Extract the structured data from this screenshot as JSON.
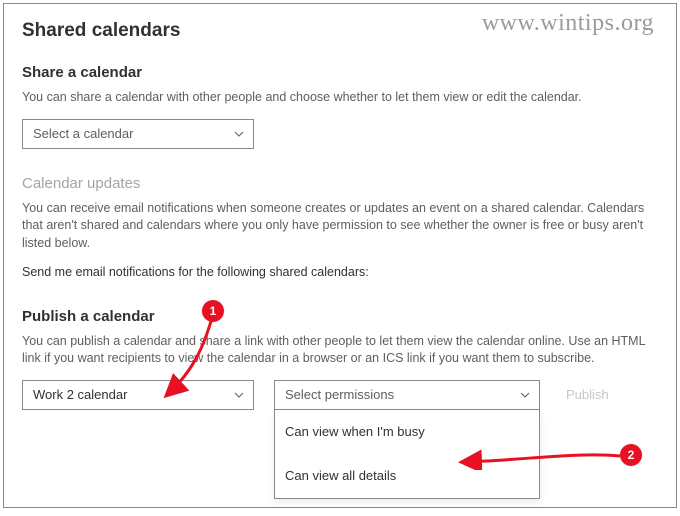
{
  "watermark": "www.wintips.org",
  "page_title": "Shared calendars",
  "share": {
    "title": "Share a calendar",
    "desc": "You can share a calendar with other people and choose whether to let them view or edit the calendar.",
    "select_placeholder": "Select a calendar"
  },
  "updates": {
    "title": "Calendar updates",
    "desc": "You can receive email notifications when someone creates or updates an event on a shared calendar. Calendars that aren't shared and calendars where you only have permission to see whether the owner is free or busy aren't listed below.",
    "prompt": "Send me email notifications for the following shared calendars:"
  },
  "publish": {
    "title": "Publish a calendar",
    "desc": "You can publish a calendar and share a link with other people to let them view the calendar online. Use an HTML link if you want recipients to view the calendar in a browser or an ICS link if you want them to subscribe.",
    "selected_calendar": "Work 2 calendar",
    "permissions_placeholder": "Select permissions",
    "options": {
      "busy": "Can view when I'm busy",
      "all": "Can view all details"
    },
    "publish_label": "Publish"
  },
  "annotations": {
    "badge1": "1",
    "badge2": "2"
  }
}
